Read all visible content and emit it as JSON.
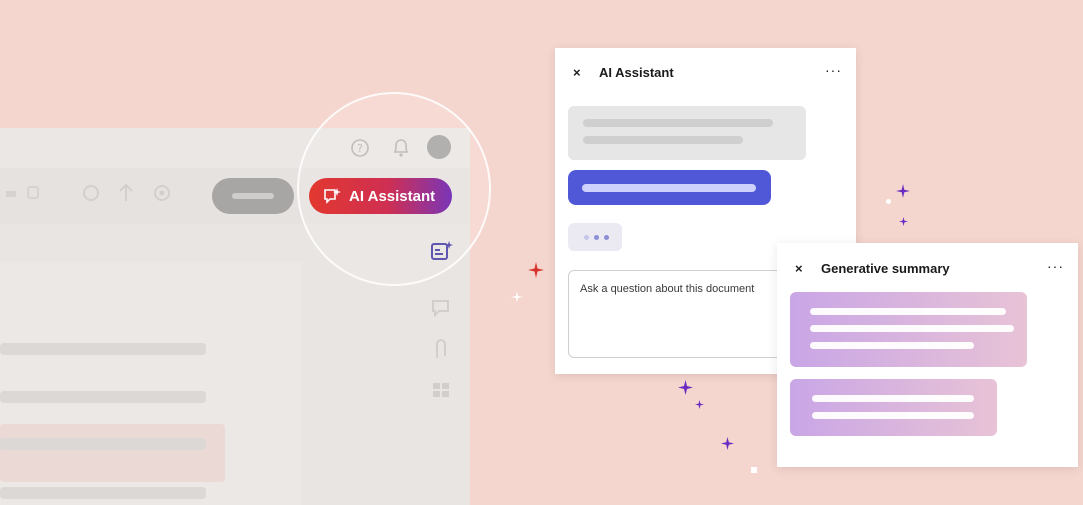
{
  "colors": {
    "background": "#f5d6cf",
    "accent_red": "#e2382f",
    "accent_purple": "#7a35b8",
    "chat_blue": "#5058d8",
    "sparkle_purple": "#6a2bc1",
    "sparkle_red": "#d8342c"
  },
  "toolbar": {
    "ai_button_label": "AI Assistant",
    "ai_button_icon": "ai-chat-sparkle-icon",
    "icons": [
      "help-icon",
      "bell-icon",
      "avatar"
    ]
  },
  "ai_panel": {
    "title": "AI Assistant",
    "close": "×",
    "more": "···",
    "input_placeholder": "Ask a question about this document"
  },
  "summary_panel": {
    "title": "Generative summary",
    "close": "×",
    "more": "···"
  }
}
